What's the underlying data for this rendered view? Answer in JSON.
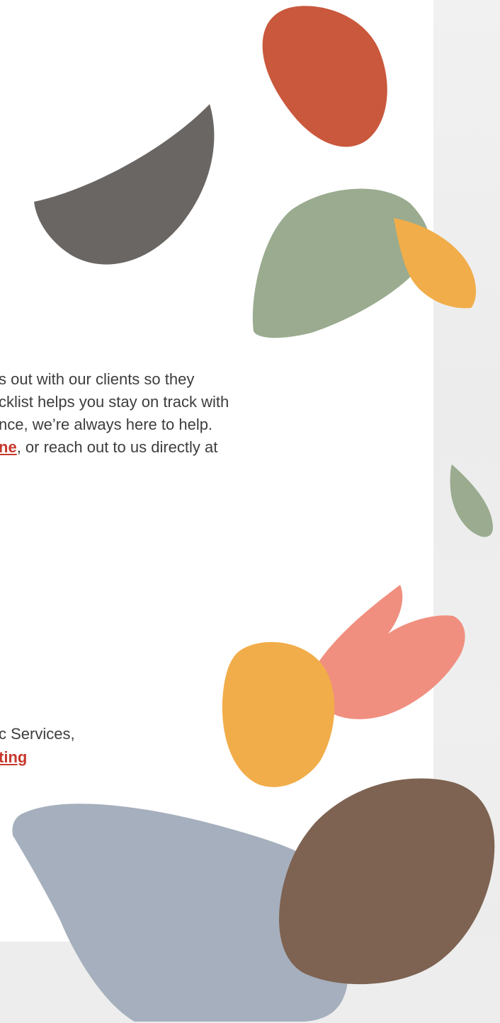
{
  "paragraph_1": {
    "line_1": "s out with our clients so they",
    "line_2": "cklist helps you stay on track with",
    "line_3": "nce, we’re always here to help.",
    "line_4_link": "ne",
    "line_4_rest": ", or reach out to us directly at"
  },
  "paragraph_2": {
    "line_1": "c Services,",
    "line_2_link": "ting"
  },
  "colors": {
    "link": "#c7382d",
    "body_text": "#3d3d3d",
    "shape_charcoal": "#6a6663",
    "shape_rust": "#c9583c",
    "shape_sage": "#9aab8f",
    "shape_amber": "#f1ad4a",
    "shape_coral": "#f08f7f",
    "shape_slate": "#a6afbd",
    "shape_brown": "#7e6352"
  }
}
